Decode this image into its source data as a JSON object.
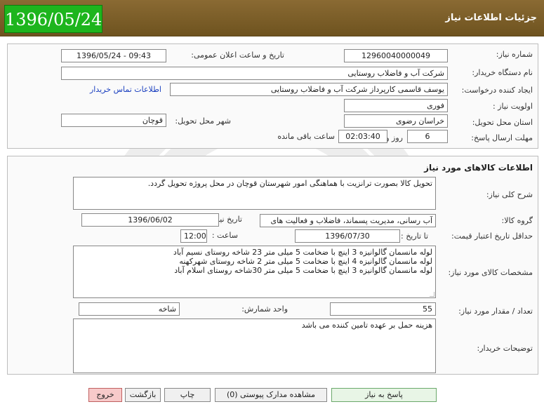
{
  "header": {
    "date": "1396/05/24",
    "title": "جزئیات اطلاعات نیاز"
  },
  "info": {
    "need_number_label": "شماره نیاز:",
    "need_number": "12960040000049",
    "announce_label": "تاریخ و ساعت اعلان عمومی:",
    "announce_value": "1396/05/24 - 09:43",
    "buyer_label": "نام دستگاه خریدار:",
    "buyer_value": "شرکت آب و فاضلاب روستایی",
    "creator_label": "ایجاد کننده درخواست:",
    "creator_value": "یوسف  قاسمی کارپرداز شرکت آب و فاضلاب روستایی",
    "contact_link": "اطلاعات تماس خریدار",
    "priority_label": "اولویت نیاز :",
    "priority_value": "فوری",
    "province_label": "استان محل تحویل:",
    "province_value": "خراسان رضوی",
    "city_label": "شهر محل تحویل:",
    "city_value": "قوچان",
    "deadline_label": "مهلت ارسال پاسخ:",
    "deadline_days": "6",
    "days_label": "روز و",
    "deadline_time": "02:03:40",
    "remaining_label": "ساعت باقی مانده"
  },
  "goods": {
    "section_title": "اطلاعات کالاهای مورد نیاز",
    "description_label": "شرح کلی نیاز:",
    "description_value": "تحویل کالا بصورت ترانزیت با هماهنگی امور شهرستان قوچان در محل پروژه تحویل گردد.",
    "group_label": "گروه کالا:",
    "group_value": "آب رسانی، مدیریت پسماند، فاضلاب و فعالیت های",
    "need_date_label": "تاریخ نیاز به کالا:",
    "need_date_value": "1396/06/02",
    "min_price_label": "حداقل تاریخ اعتبار قیمت:",
    "until_date_label": "تا تاریخ :",
    "until_date_value": "1396/07/30",
    "time_label": "ساعت :",
    "time_value": "12:00",
    "specs_label": "مشخصات کالای مورد نیاز:",
    "specs_lines": [
      "لوله مانسمان گالوانیزه 3 اینچ با ضخامت 5 میلی متر 23 شاخه روستای نسیم آباد",
      "لوله مانسمان گالوانیزه 4 اینچ با ضخامت 5 میلی متر 2 شاخه روستای شهرکهنه",
      "لوله مانسمان گالوانیزه 3 اینچ با ضخامت 5 میلی متر 30شاخه روستای اسلام آباد"
    ],
    "qty_label": "تعداد / مقدار مورد نیاز:",
    "qty_value": "55",
    "unit_label": "واحد شمارش:",
    "unit_value": "شاخه",
    "buyer_notes_label": "توضیحات خریدار:",
    "buyer_notes_value": "هزینه حمل بر عهده تامین کننده می باشد"
  },
  "buttons": {
    "respond": "پاسخ به نیاز",
    "attachments": "مشاهده مدارک پیوستی (0)",
    "print": "چاپ",
    "back": "بازگشت",
    "exit": "خروج"
  },
  "colors": {
    "header_bg": "#7a5c28",
    "date_badge": "#1db51d",
    "exit_button": "#f7caca",
    "link": "#1a3fbf"
  }
}
